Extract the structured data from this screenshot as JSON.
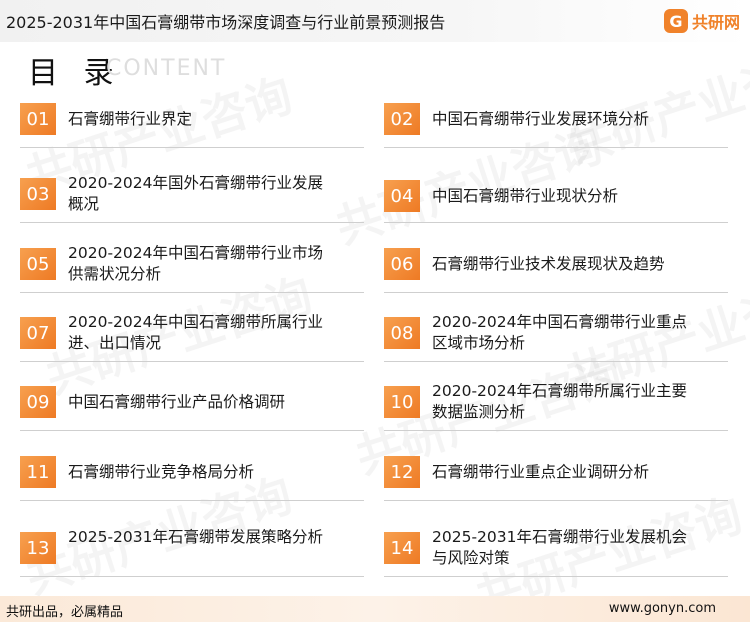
{
  "header": {
    "title": "2025-2031年中国石膏绷带市场深度调查与行业前景预测报告",
    "brand_mark": "G",
    "brand_text": "共研网"
  },
  "toc": {
    "heading": "目 录",
    "subheading": "CONTENT",
    "items": [
      {
        "num": "01",
        "label": "石膏绷带行业界定"
      },
      {
        "num": "02",
        "label": "中国石膏绷带行业发展环境分析"
      },
      {
        "num": "03",
        "label": "2020-2024年国外石膏绷带行业发展概况"
      },
      {
        "num": "04",
        "label": "中国石膏绷带行业现状分析"
      },
      {
        "num": "05",
        "label": "2020-2024年中国石膏绷带行业市场供需状况分析"
      },
      {
        "num": "06",
        "label": "石膏绷带行业技术发展现状及趋势"
      },
      {
        "num": "07",
        "label": "2020-2024年中国石膏绷带所属行业进、出口情况"
      },
      {
        "num": "08",
        "label": "2020-2024年中国石膏绷带行业重点区域市场分析"
      },
      {
        "num": "09",
        "label": "中国石膏绷带行业产品价格调研"
      },
      {
        "num": "10",
        "label": "2020-2024年石膏绷带所属行业主要数据监测分析"
      },
      {
        "num": "11",
        "label": "石膏绷带行业竞争格局分析"
      },
      {
        "num": "12",
        "label": "石膏绷带行业重点企业调研分析"
      },
      {
        "num": "13",
        "label": "2025-2031年石膏绷带发展策略分析"
      },
      {
        "num": "14",
        "label": "2025-2031年石膏绷带行业发展机会与风险对策"
      }
    ]
  },
  "watermark": "共研产业咨询",
  "footer": {
    "left": "共研出品，必属精品",
    "right": "www.gonyn.com"
  },
  "colors": {
    "accent": "#ee7a24",
    "footer_bg": "#fbe9d8"
  }
}
